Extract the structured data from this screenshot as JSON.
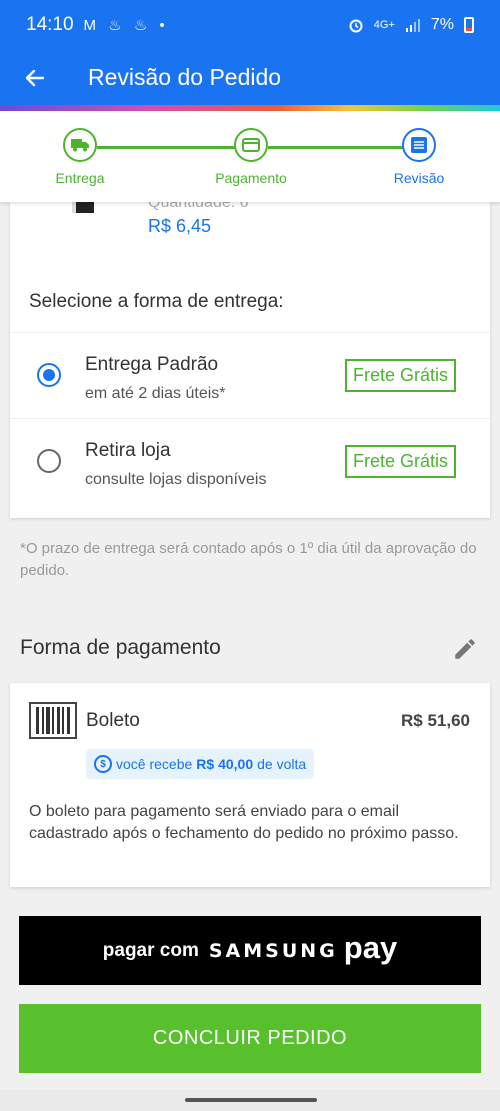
{
  "status_bar": {
    "time": "14:10",
    "notif_icons": "M ♨ ♨ •",
    "network": "4G+",
    "battery": "7%"
  },
  "app_bar": {
    "title": "Revisão do Pedido"
  },
  "steps": [
    {
      "label": "Entrega",
      "state": "done",
      "icon": "truck-icon"
    },
    {
      "label": "Pagamento",
      "state": "done",
      "icon": "card-icon"
    },
    {
      "label": "Revisão",
      "state": "current",
      "icon": "list-icon"
    }
  ],
  "product": {
    "quantity": "Quantidade:  6",
    "price": "R$ 6,45"
  },
  "delivery": {
    "title": "Selecione a forma de entrega:",
    "options": [
      {
        "title": "Entrega Padrão",
        "subtitle": "em até 2 dias úteis*",
        "badge": "Frete Grátis",
        "selected": true
      },
      {
        "title": "Retira loja",
        "subtitle": "consulte lojas disponíveis",
        "badge": "Frete Grátis",
        "selected": false
      }
    ],
    "note": "*O prazo de entrega será contado após o 1º dia útil da aprovação do pedido."
  },
  "payment": {
    "title": "Forma de pagamento",
    "method": "Boleto",
    "amount": "R$ 51,60",
    "cashback_prefix": "você recebe",
    "cashback_amount": "R$ 40,00",
    "cashback_suffix": "de volta",
    "description": "O boleto para pagamento será enviado para o email cadastrado após o fechamento do pedido no próximo passo."
  },
  "samsung_pay": {
    "text": "pagar com",
    "brand": "SAMSUNG",
    "pay": "pay"
  },
  "conclude_button": "CONCLUIR PEDIDO",
  "colors": {
    "primary": "#1a73f0",
    "success": "#4cb42f",
    "button_green": "#57c02c"
  }
}
